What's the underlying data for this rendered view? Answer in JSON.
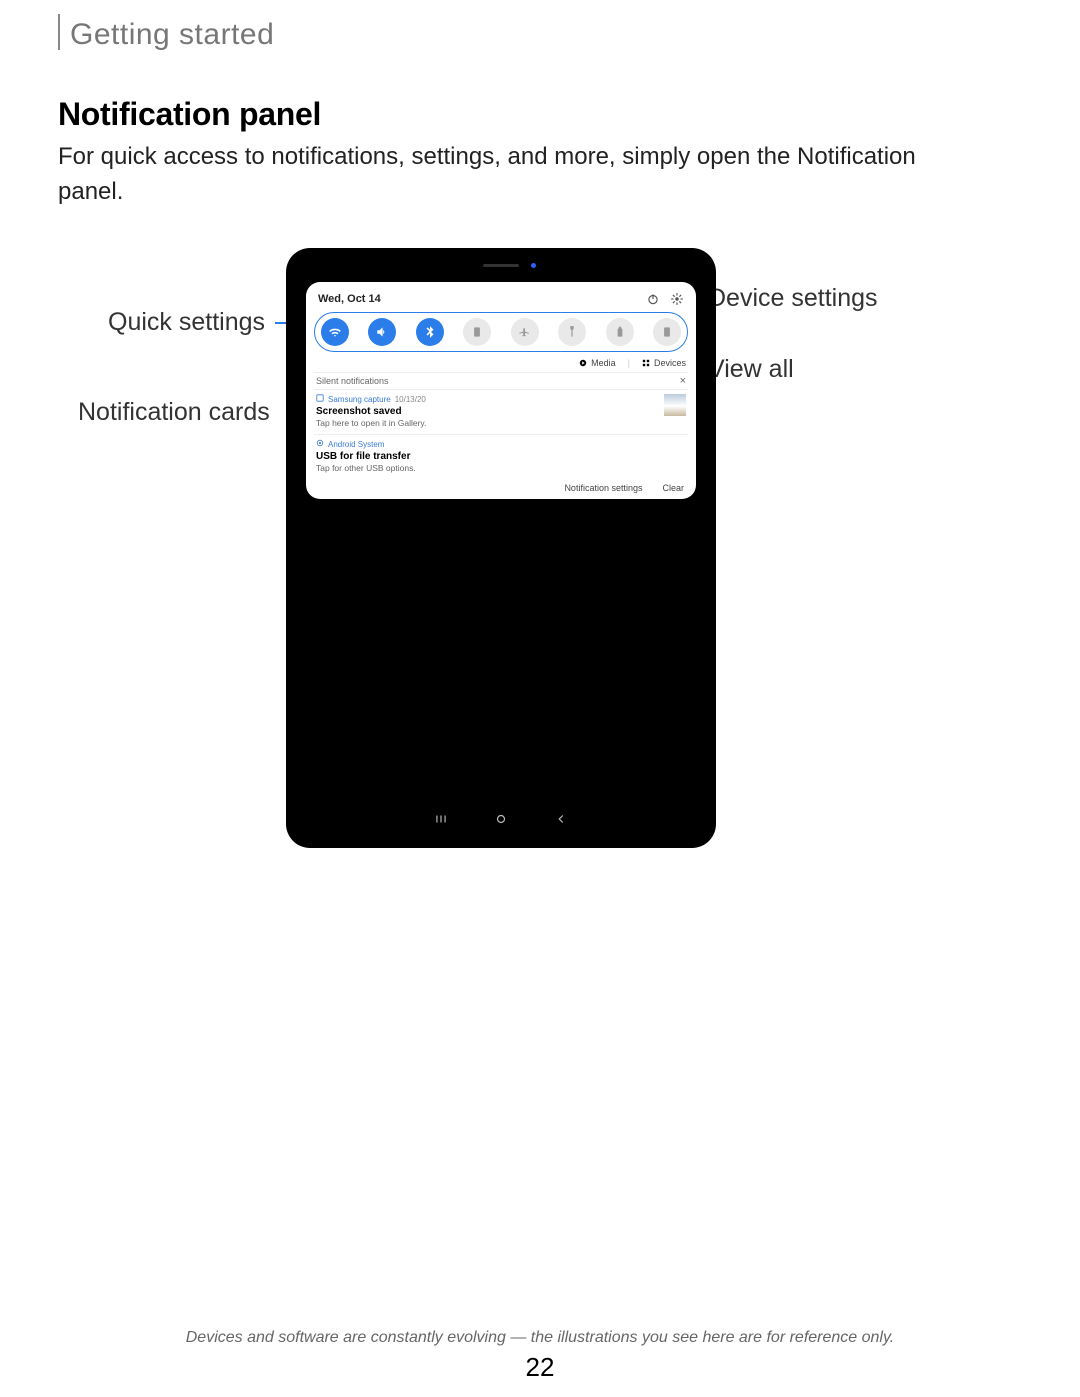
{
  "breadcrumb": "Getting started",
  "heading": "Notification panel",
  "body": "For quick access to notifications, settings, and more, simply open the Notification panel.",
  "callouts": {
    "quick_settings": "Quick settings",
    "notification_cards": "Notification cards",
    "device_settings": "Device settings",
    "view_all": "View all"
  },
  "shade": {
    "date": "Wed, Oct 14",
    "media_label": "Media",
    "devices_label": "Devices",
    "silent_header": "Silent notifications",
    "notif1": {
      "app": "Samsung capture",
      "time": "10/13/20",
      "title": "Screenshot saved",
      "sub": "Tap here to open it in Gallery."
    },
    "notif2": {
      "app": "Android System",
      "title": "USB for file transfer",
      "sub": "Tap for other USB options."
    },
    "footer_settings": "Notification settings",
    "footer_clear": "Clear"
  },
  "disclaimer": "Devices and software are constantly evolving — the illustrations you see here are for reference only.",
  "page_number": "22"
}
